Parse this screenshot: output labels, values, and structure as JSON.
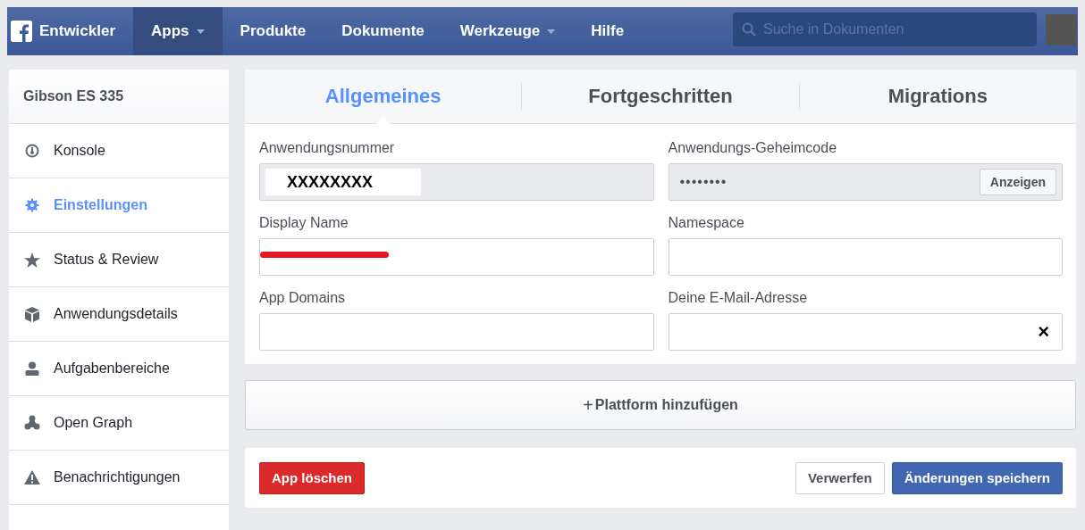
{
  "nav": {
    "brand": "Entwickler",
    "items": [
      {
        "label": "Apps",
        "selected": true,
        "dropdown": true
      },
      {
        "label": "Produkte",
        "selected": false,
        "dropdown": false
      },
      {
        "label": "Dokumente",
        "selected": false,
        "dropdown": false
      },
      {
        "label": "Werkzeuge",
        "selected": false,
        "dropdown": true
      },
      {
        "label": "Hilfe",
        "selected": false,
        "dropdown": false
      }
    ],
    "search": {
      "placeholder": "Suche in Dokumenten"
    }
  },
  "sidebar": {
    "title": "Gibson ES 335",
    "items": [
      {
        "label": "Konsole",
        "kind": "gauge",
        "selected": false
      },
      {
        "label": "Einstellungen",
        "kind": "gear",
        "selected": true
      },
      {
        "label": "Status & Review",
        "kind": "star",
        "selected": false
      },
      {
        "label": "Anwendungsdetails",
        "kind": "cube",
        "selected": false
      },
      {
        "label": "Aufgabenbereiche",
        "kind": "person",
        "selected": false
      },
      {
        "label": "Open Graph",
        "kind": "graph",
        "selected": false
      },
      {
        "label": "Benachrichtigungen",
        "kind": "warning",
        "selected": false
      }
    ]
  },
  "tabs": [
    {
      "label": "Allgemeines",
      "selected": true
    },
    {
      "label": "Fortgeschritten",
      "selected": false
    },
    {
      "label": "Migrations",
      "selected": false
    }
  ],
  "fields": [
    {
      "label": "Anwendungsnummer",
      "kind": "readonly",
      "value": "XXXXXXXX"
    },
    {
      "label": "Anwendungs-Geheimcode",
      "kind": "secret",
      "value": "••••••••",
      "button": "Anzeigen"
    },
    {
      "label": "Display Name",
      "kind": "redacted"
    },
    {
      "label": "Namespace",
      "kind": "text"
    },
    {
      "label": "App Domains",
      "kind": "text"
    },
    {
      "label": "Deine E-Mail-Adresse",
      "kind": "clearable",
      "clear": "×"
    }
  ],
  "add_platform": {
    "icon": "+",
    "label": "Plattform hinzufügen"
  },
  "actions": {
    "delete": "App löschen",
    "discard": "Verwerfen",
    "save": "Änderungen speichern"
  }
}
